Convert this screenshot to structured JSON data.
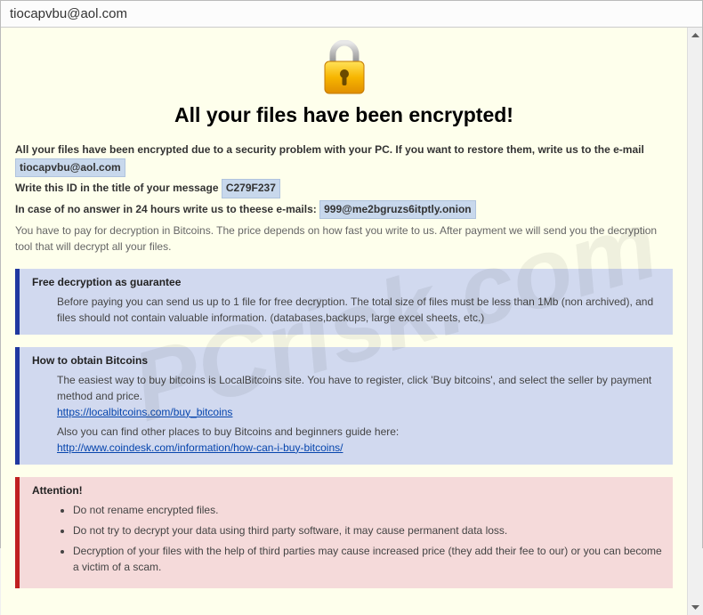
{
  "window": {
    "title": "tiocapvbu@aol.com"
  },
  "main_heading": "All your files have been encrypted!",
  "intro": {
    "line1_pre": "All your files have been encrypted due to a security problem with your PC. If you want to restore them, write us to the e-mail ",
    "email1": "tiocapvbu@aol.com",
    "line2_pre": "Write this ID in the title of your message ",
    "id": "C279F237",
    "line3_pre": "In case of no answer in 24 hours write us to theese e-mails: ",
    "email2": "999@me2bgruzs6itptly.onion",
    "sub": "You have to pay for decryption in Bitcoins. The price depends on how fast you write to us. After payment we will send you the decryption tool that will decrypt all your files."
  },
  "panels": {
    "free": {
      "title": "Free decryption as guarantee",
      "body": "Before paying you can send us up to 1 file for free decryption. The total size of files must be less than 1Mb (non archived), and files should not contain valuable information. (databases,backups, large excel sheets, etc.)"
    },
    "bitcoins": {
      "title": "How to obtain Bitcoins",
      "line1": "The easiest way to buy bitcoins is LocalBitcoins site. You have to register, click 'Buy bitcoins', and select the seller by payment method and price.",
      "link1": "https://localbitcoins.com/buy_bitcoins",
      "line2": "Also you can find other places to buy Bitcoins and beginners guide here:",
      "link2": "http://www.coindesk.com/information/how-can-i-buy-bitcoins/"
    },
    "attention": {
      "title": "Attention!",
      "items": [
        "Do not rename encrypted files.",
        "Do not try to decrypt your data using third party software, it may cause permanent data loss.",
        "Decryption of your files with the help of third parties may cause increased price (they add their fee to our) or you can become a victim of a scam."
      ]
    }
  },
  "watermark": "PCrisk.com"
}
